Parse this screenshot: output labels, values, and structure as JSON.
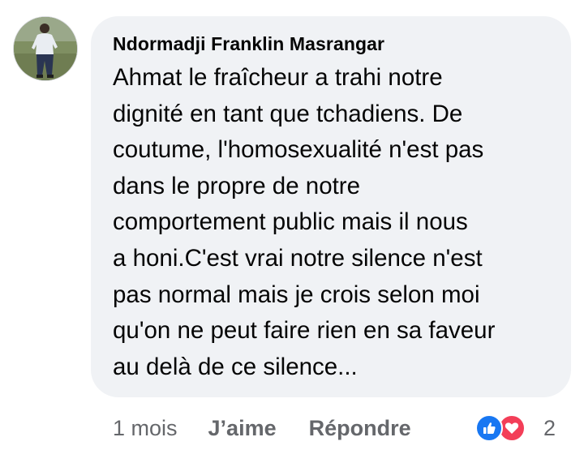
{
  "comment": {
    "author": "Ndormadji Franklin Masrangar",
    "text_lines": [
      "Ahmat le fraîcheur a trahi notre",
      "dignité en tant que tchadiens. De",
      "coutume, l'homosexualité n'est pas",
      "dans le propre de notre",
      "comportement public mais il nous",
      "a honi.C'est vrai notre silence n'est",
      "pas normal mais je crois selon moi",
      "qu'on ne peut faire rien en sa faveur",
      "au delà de ce silence..."
    ]
  },
  "actions": {
    "time": "1 mois",
    "like_label": "J’aime",
    "reply_label": "Répondre"
  },
  "reactions": {
    "icons": [
      "like-icon",
      "love-icon"
    ],
    "count": "2",
    "colors": {
      "like": "#1877f2",
      "love": "#f33e58"
    }
  },
  "colors": {
    "bubble": "#f0f2f5",
    "text": "#050505",
    "secondary": "#65676b"
  }
}
